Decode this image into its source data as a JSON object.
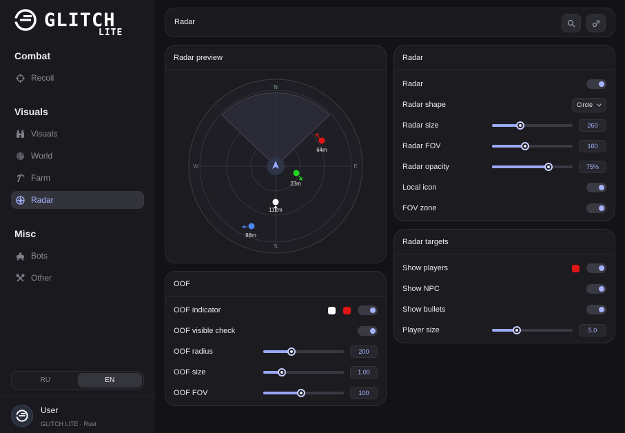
{
  "app": {
    "logo_word": "GLITCH",
    "logo_sub": "LITE"
  },
  "sidebar": {
    "sections": [
      {
        "title": "Combat",
        "items": [
          {
            "label": "Recoil",
            "icon": "crosshair-icon"
          }
        ]
      },
      {
        "title": "Visuals",
        "items": [
          {
            "label": "Visuals",
            "icon": "binoculars-icon"
          },
          {
            "label": "World",
            "icon": "globe-icon"
          },
          {
            "label": "Farm",
            "icon": "pickaxe-icon"
          },
          {
            "label": "Radar",
            "icon": "radar-icon",
            "active": true
          }
        ]
      },
      {
        "title": "Misc",
        "items": [
          {
            "label": "Bots",
            "icon": "bot-icon"
          },
          {
            "label": "Other",
            "icon": "tools-icon"
          }
        ]
      }
    ],
    "languages": [
      "RU",
      "EN"
    ],
    "active_language": "EN",
    "user": {
      "name": "User",
      "subtitle": "GLITCH LITE · Rust"
    }
  },
  "topbar": {
    "title": "Radar",
    "buttons": [
      "search-icon",
      "settings-icon"
    ]
  },
  "radar_preview": {
    "title": "Radar preview",
    "compass": {
      "n": "N",
      "s": "S",
      "e": "E",
      "w": "W"
    },
    "targets": [
      {
        "label": "64m",
        "color": "#e01515"
      },
      {
        "label": "23m",
        "color": "#1fd51f"
      },
      {
        "label": "112m",
        "color": "#ffffff"
      },
      {
        "label": "88m",
        "color": "#4c86f0"
      }
    ]
  },
  "oof": {
    "title": "OOF",
    "indicator": {
      "label": "OOF indicator",
      "color1": "#ffffff",
      "color2": "#e01515",
      "on": true
    },
    "visible_check": {
      "label": "OOF visible check",
      "on": true
    },
    "radius": {
      "label": "OOF radius",
      "value": "200",
      "fraction": 0.35
    },
    "size": {
      "label": "OOF size",
      "value": "1.00",
      "fraction": 0.23
    },
    "fov": {
      "label": "OOF FOV",
      "value": "100",
      "fraction": 0.47
    }
  },
  "radar": {
    "title": "Radar",
    "enabled": {
      "label": "Radar",
      "on": true
    },
    "shape": {
      "label": "Radar shape",
      "value": "Circle"
    },
    "size": {
      "label": "Radar size",
      "value": "260",
      "fraction": 0.35
    },
    "fov": {
      "label": "Radar FOV",
      "value": "160",
      "fraction": 0.41
    },
    "opacity": {
      "label": "Radar opacity",
      "value": "75%",
      "fraction": 0.7
    },
    "local_icon": {
      "label": "Local icon",
      "on": true
    },
    "fov_zone": {
      "label": "FOV zone",
      "on": true
    }
  },
  "targets": {
    "title": "Radar targets",
    "players": {
      "label": "Show players",
      "color": "#e01515",
      "on": true
    },
    "npc": {
      "label": "Show NPC",
      "on": true
    },
    "bullets": {
      "label": "Show bullets",
      "on": true
    },
    "player_size": {
      "label": "Player size",
      "value": "5.0",
      "fraction": 0.31
    }
  }
}
